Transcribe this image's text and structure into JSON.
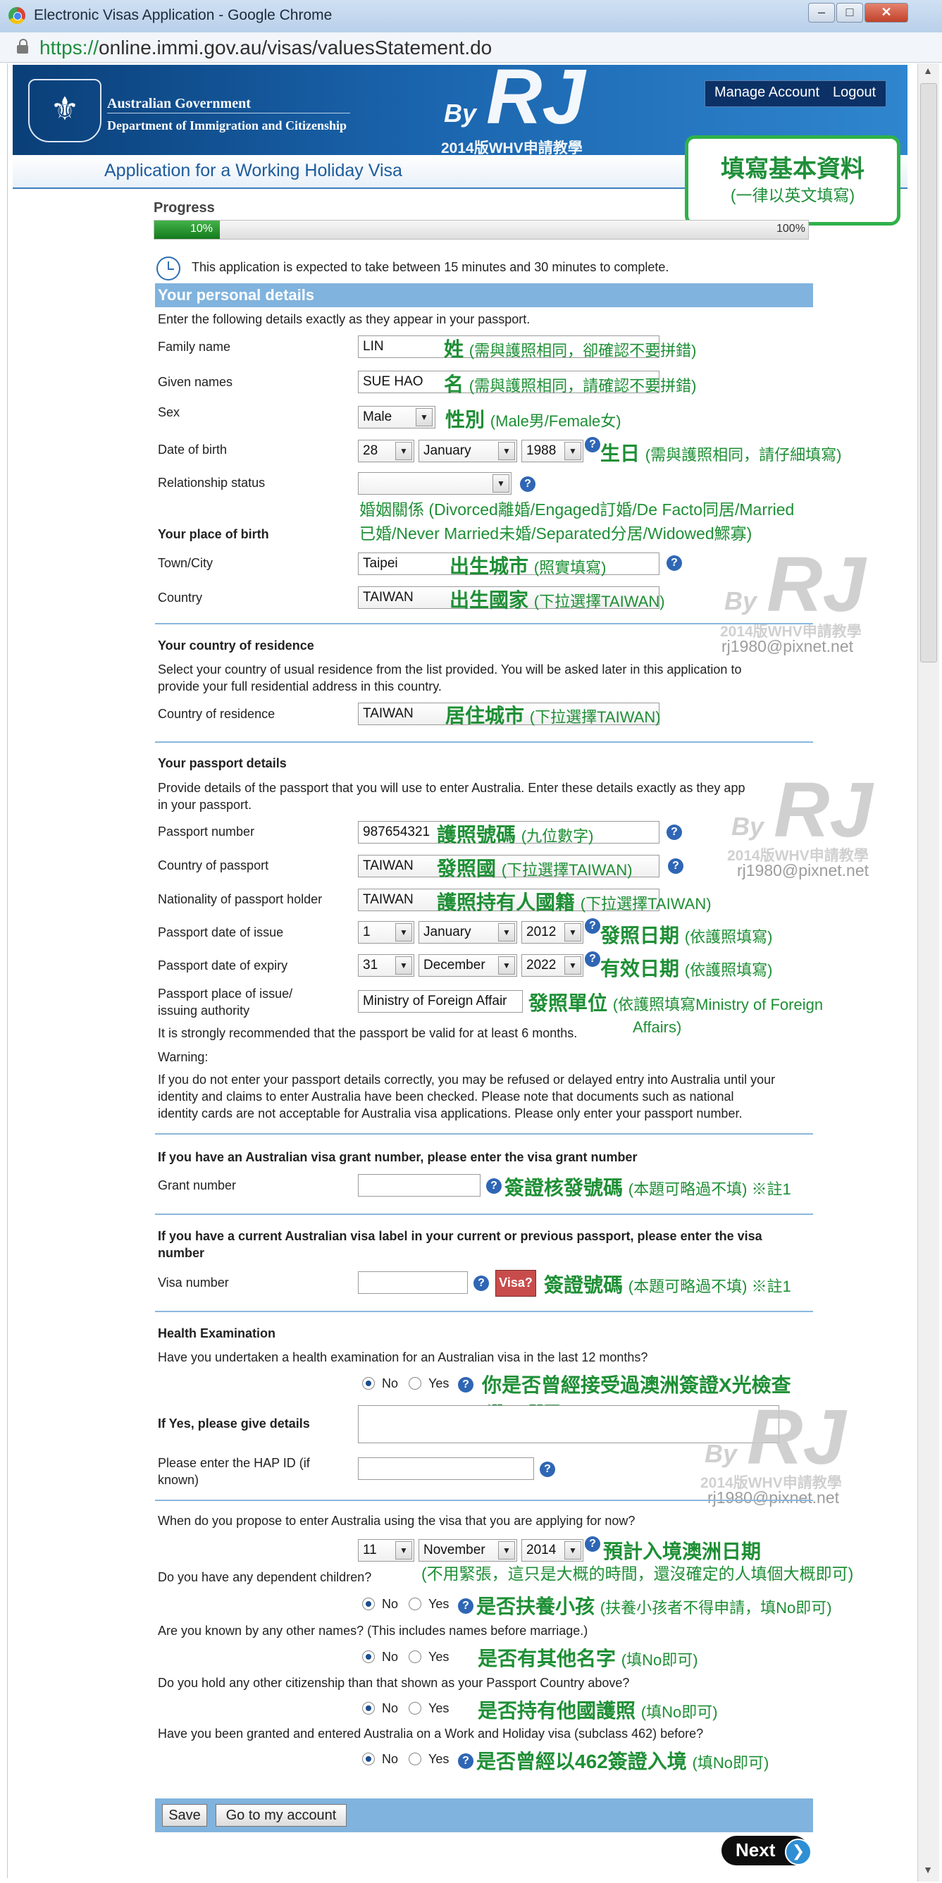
{
  "window": {
    "title": "Electronic Visas Application - Google Chrome",
    "url_secure": "https://",
    "url_rest": "online.immi.gov.au/visas/valuesStatement.do",
    "min": "–",
    "max": "□",
    "close": "✕"
  },
  "header": {
    "gov_line1": "Australian Government",
    "gov_line2": "Department of Immigration and Citizenship",
    "manage_account": "Manage Account",
    "logout": "Logout",
    "app_title": "Application for a Working Holiday Visa",
    "crest_glyph": "⚜"
  },
  "watermark": {
    "by": "By",
    "rj": "RJ",
    "sub": "2014版WHV申請教學",
    "mail": "rj1980@pixnet.net"
  },
  "note": {
    "title": "填寫基本資料",
    "subtitle": "(一律以英文填寫)"
  },
  "progress": {
    "label": "Progress",
    "value": 10,
    "current": "10%",
    "end": "100%"
  },
  "time_notice": "This application is expected to take between 15 minutes and 30 minutes to complete.",
  "section_title": "Your personal details",
  "intro": "Enter the following details exactly as they appear in your passport.",
  "fields": {
    "family_name": {
      "label": "Family name",
      "value": "LIN",
      "anno": "姓",
      "anno_small": "(需與護照相同，卻確認不要拼錯)"
    },
    "given_names": {
      "label": "Given names",
      "value": "SUE HAO",
      "anno": "名",
      "anno_small": "(需與護照相同，請確認不要拼錯)"
    },
    "sex": {
      "label": "Sex",
      "value": "Male",
      "anno": "性別",
      "anno_small": "(Male男/Female女)"
    },
    "dob": {
      "label": "Date of birth",
      "day": "28",
      "month": "January",
      "year": "1988",
      "anno": "生日",
      "anno_small": "(需與護照相同，請仔細填寫)"
    },
    "relationship": {
      "label": "Relationship status",
      "value": "",
      "anno_line1": "婚姻關係 (Divorced離婚/Engaged訂婚/De Facto同居/Married",
      "anno_line2": "已婚/Never Married未婚/Separated分居/Widowed鰥寡)"
    },
    "place_of_birth_heading": "Your place of birth",
    "town": {
      "label": "Town/City",
      "value": "Taipei",
      "anno": "出生城市",
      "anno_small": "(照實填寫)"
    },
    "country": {
      "label": "Country",
      "value": "TAIWAN",
      "anno": "出生國家",
      "anno_small": "(下拉選擇TAIWAN)"
    },
    "residence_heading": "Your country of residence",
    "residence_intro1": "Select your country of usual residence from the list provided. You will be asked later in this application to",
    "residence_intro2": "provide your full residential address in this country.",
    "residence": {
      "label": "Country of residence",
      "value": "TAIWAN",
      "anno": "居住城市",
      "anno_small": "(下拉選擇TAIWAN)"
    },
    "passport_heading": "Your passport details",
    "passport_intro1": "Provide details of the passport that you will use to enter Australia. Enter these details exactly as they app",
    "passport_intro2": "in your passport.",
    "passport_number": {
      "label": "Passport number",
      "value": "987654321",
      "anno": "護照號碼",
      "anno_small": "(九位數字)"
    },
    "passport_country": {
      "label": "Country of passport",
      "value": "TAIWAN",
      "anno": "發照國",
      "anno_small": "(下拉選擇TAIWAN)"
    },
    "nationality": {
      "label": "Nationality of passport holder",
      "value": "TAIWAN",
      "anno": "護照持有人國籍",
      "anno_small": "(下拉選擇TAIWAN)"
    },
    "issue_date": {
      "label": "Passport date of issue",
      "day": "1",
      "month": "January",
      "year": "2012",
      "anno": "發照日期",
      "anno_small": "(依護照填寫)"
    },
    "expiry_date": {
      "label": "Passport date of expiry",
      "day": "31",
      "month": "December",
      "year": "2022",
      "anno": "有效日期",
      "anno_small": "(依護照填寫)"
    },
    "issue_place": {
      "label1": "Passport place of issue/",
      "label2": "issuing authority",
      "value": "Ministry of Foreign Affair",
      "anno": "發照單位",
      "anno_small": "(依護照填寫Ministry of Foreign",
      "anno_small2": "Affairs)"
    },
    "valid_note": "It is strongly recommended that the passport be valid for at least 6 months.",
    "warning_label": "Warning:",
    "warning1": "If you do not enter your passport details correctly, you may be refused or delayed entry into Australia until your",
    "warning2": "identity and claims to enter Australia have been checked. Please note that documents such as national",
    "warning3": "identity cards are not acceptable for Australia visa applications. Please only enter your passport number.",
    "grant_heading": "If you have an Australian visa grant number, please enter the visa grant number",
    "grant": {
      "label": "Grant number",
      "value": "",
      "anno": "簽證核發號碼",
      "anno_small": "(本題可略過不填) ※註1"
    },
    "label_heading1": "If you have a current Australian visa label in your current or previous passport, please enter the visa",
    "label_heading2": "number",
    "visa_number": {
      "label": "Visa number",
      "value": "",
      "icon_text": "Visa?",
      "anno": "簽證號碼",
      "anno_small": "(本題可略過不填) ※註1"
    },
    "health_heading": "Health Examination",
    "health_q": "Have you undertaken a health examination for an Australian visa in the last 12 months?",
    "health_anno": "你是否曾經接受過澳洲簽證X光檢查",
    "health_anno2": "(選NO即可)",
    "if_yes_label": "If Yes, please give details",
    "hap_label1": "Please enter the HAP ID (if",
    "hap_label2": "known)",
    "enter_q": "When do you propose to enter Australia using the visa that you are applying for now?",
    "enter_date": {
      "day": "11",
      "month": "November",
      "year": "2014",
      "anno": "預計入境澳洲日期",
      "anno_small": "(不用緊張，這只是大概的時間，還沒確定的人填個大概即可)"
    },
    "children_q": "Do you have any dependent children?",
    "children_anno": "是否扶養小孩",
    "children_anno_small": "(扶養小孩者不得申請，填No即可)",
    "other_names_q": "Are you known by any other names? (This includes names before marriage.)",
    "other_names_anno": "是否有其他名字",
    "other_names_anno_small": "(填No即可)",
    "citizenship_q": "Do you hold any other citizenship than that shown as your Passport Country above?",
    "citizenship_anno": "是否持有他國護照",
    "citizenship_anno_small": "(填No即可)",
    "whv_q": "Have you been granted and entered Australia on a Work and Holiday visa (subclass 462) before?",
    "whv_anno": "是否曾經以462簽證入境",
    "whv_anno_small": "(填No即可)"
  },
  "radio": {
    "no": "No",
    "yes": "Yes"
  },
  "buttons": {
    "save": "Save",
    "go_to_account": "Go to my account",
    "next": "Next"
  },
  "icons": {
    "help": "?",
    "arrow_down": "▼",
    "next_arrow": "❯"
  },
  "colors": {
    "annotation": "#1e8f35",
    "section": "#80b3dd",
    "header": "#1a64ad"
  }
}
